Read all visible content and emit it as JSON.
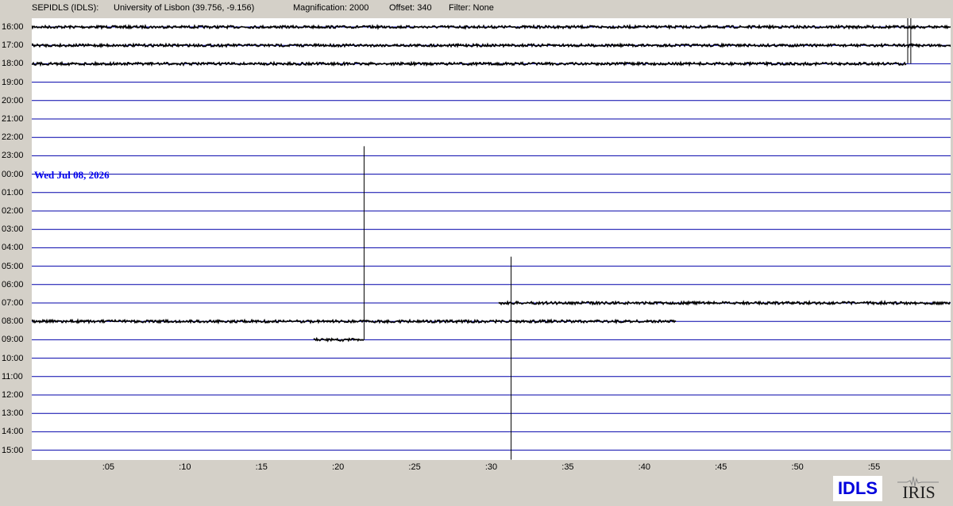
{
  "header": {
    "station": "SEPIDLS (IDLS):",
    "location": "University of Lisbon (39.756, -9.156)",
    "magnification": "Magnification: 2000",
    "offset": "Offset: 340",
    "filter": "Filter: None"
  },
  "date_label": "Wed Jul 08, 2026",
  "hour_labels": [
    "16:00",
    "17:00",
    "18:00",
    "19:00",
    "20:00",
    "21:00",
    "22:00",
    "23:00",
    "00:00",
    "01:00",
    "02:00",
    "03:00",
    "04:00",
    "05:00",
    "06:00",
    "07:00",
    "08:00",
    "09:00",
    "10:00",
    "11:00",
    "12:00",
    "13:00",
    "14:00",
    "15:00"
  ],
  "minute_labels": [
    ":05",
    ":10",
    ":15",
    ":20",
    ":25",
    ":30",
    ":35",
    ":40",
    ":45",
    ":50",
    ":55"
  ],
  "logos": {
    "idls": "IDLS",
    "iris": "IRIS"
  },
  "colors": {
    "grid_line": "#0000aa",
    "trace": "#000000",
    "date_label": "#0000ee",
    "background": "#d4d0c8",
    "plot_bg": "#ffffff"
  },
  "chart_data": {
    "type": "helicorder",
    "minutes_per_row": 60,
    "traces": [
      {
        "row": "16:00",
        "start_min": 0,
        "end_min": 60
      },
      {
        "row": "17:00",
        "start_min": 0,
        "end_min": 60
      },
      {
        "row": "18:00",
        "start_min": 0,
        "end_min": 57.1
      },
      {
        "row": "07:00",
        "start_min": 30.5,
        "end_min": 60
      },
      {
        "row": "08:00",
        "start_min": 0,
        "end_min": 42.1
      },
      {
        "row": "09:00",
        "start_min": 18.4,
        "end_min": 21.7
      }
    ],
    "spikes": [
      {
        "minute": 57.2,
        "from_row": "16:00",
        "to_row": "18:00"
      },
      {
        "minute": 57.4,
        "from_row": "16:00",
        "to_row": "18:00"
      },
      {
        "minute": 21.7,
        "from_row": "23:00",
        "to_row": "09:00"
      },
      {
        "minute": 31.3,
        "from_row": "05:00",
        "to_row": "15:00"
      }
    ]
  }
}
